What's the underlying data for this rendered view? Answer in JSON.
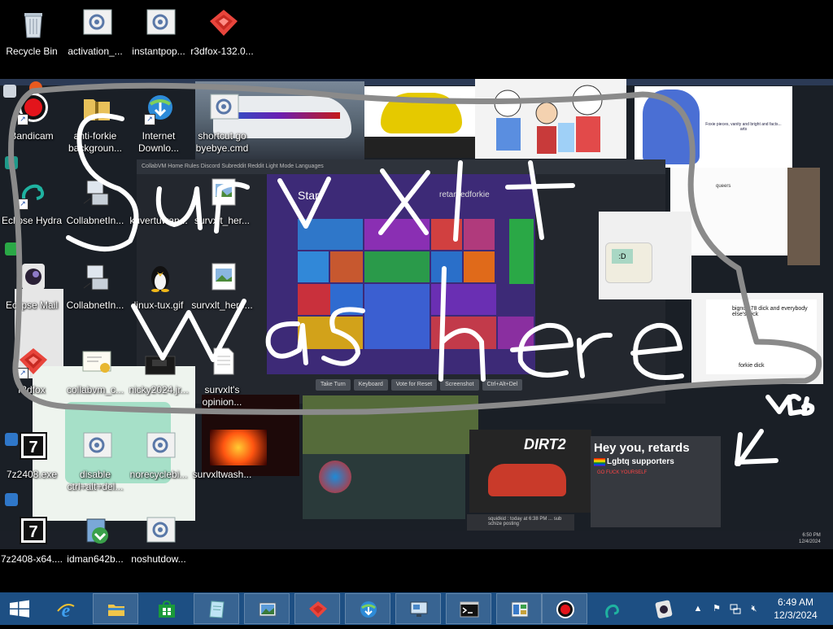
{
  "desktop": {
    "icons": [
      {
        "label": "Recycle Bin"
      },
      {
        "label": "activation_..."
      },
      {
        "label": "instantpop..."
      },
      {
        "label": "r3dfox-132.0..."
      },
      {
        "label": "Bandicam"
      },
      {
        "label": "anti-forkie backgroun..."
      },
      {
        "label": "Internet Downlo..."
      },
      {
        "label": "shortcut go byebye.cmd"
      },
      {
        "label": "Eclipse Hydra"
      },
      {
        "label": "CollabnetIn..."
      },
      {
        "label": "kuvertuwan..."
      },
      {
        "label": "survxlt_her..."
      },
      {
        "label": "Eclipse Mail"
      },
      {
        "label": "CollabnetIn..."
      },
      {
        "label": "linux-tux.gif"
      },
      {
        "label": "survxlt_here..."
      },
      {
        "label": "r3dfox"
      },
      {
        "label": "collabvm_c..."
      },
      {
        "label": "nicky2024.jr..."
      },
      {
        "label": "survxlt's opinion..."
      },
      {
        "label": "7z2408.exe"
      },
      {
        "label": "disable ctrl+alt+del..."
      },
      {
        "label": "norecyclebi..."
      },
      {
        "label": "survxltwash..."
      },
      {
        "label": "7z2408-x64...."
      },
      {
        "label": "idman642b..."
      },
      {
        "label": "noshutdow..."
      }
    ]
  },
  "scribble": {
    "text_line1": "survxlt",
    "text_line2": "was here",
    "tag": "VM6",
    "color": "#ffffff",
    "gray_outline": "#8a8a8a"
  },
  "inner_screen": {
    "start_title": "Start",
    "start_user": "retardedforkie",
    "toolbar_text": "CollabVM   Home   Rules   Discord   Subreddit   Reddit   Light Mode   Languages",
    "vm_buttons": [
      "Take Turn",
      "Keyboard",
      "Vote for Reset",
      "Screenshot",
      "Ctrl+Alt+Del"
    ],
    "cat_caption": "Foxie pieces, vanity and bright and facts... arts",
    "sketch_label": "queers",
    "paint_text1": "bignuts78 dick and everybody else's dick",
    "paint_text2": "forkie dick",
    "robot_face": ":D",
    "dirt_title": "DIRT2",
    "discord_title": "Hey you, retards",
    "discord_sub": "Lgbtq supporters",
    "discord_line": "GO FUCK YOURSELF",
    "chat_text": "squidkid : today at 6:38 PM ... sub schize posting",
    "clock_time": "6:50 PM",
    "clock_date": "12/4/2024",
    "overlay_date": "12/4/2024"
  },
  "taskbar": {
    "apps": [
      {
        "name": "Internet Explorer"
      },
      {
        "name": "File Explorer"
      },
      {
        "name": "Store"
      },
      {
        "name": "Notepad"
      },
      {
        "name": "Photo Viewer"
      },
      {
        "name": "r3dfox"
      },
      {
        "name": "Internet Download Manager"
      },
      {
        "name": "Remote Desktop"
      },
      {
        "name": "Command Prompt"
      },
      {
        "name": "Control Panel"
      },
      {
        "name": "Bandicam"
      },
      {
        "name": "Eclipse Hydra"
      },
      {
        "name": "Eclipse Mail"
      }
    ],
    "clock": {
      "time": "6:49 AM",
      "date": "12/3/2024"
    }
  }
}
